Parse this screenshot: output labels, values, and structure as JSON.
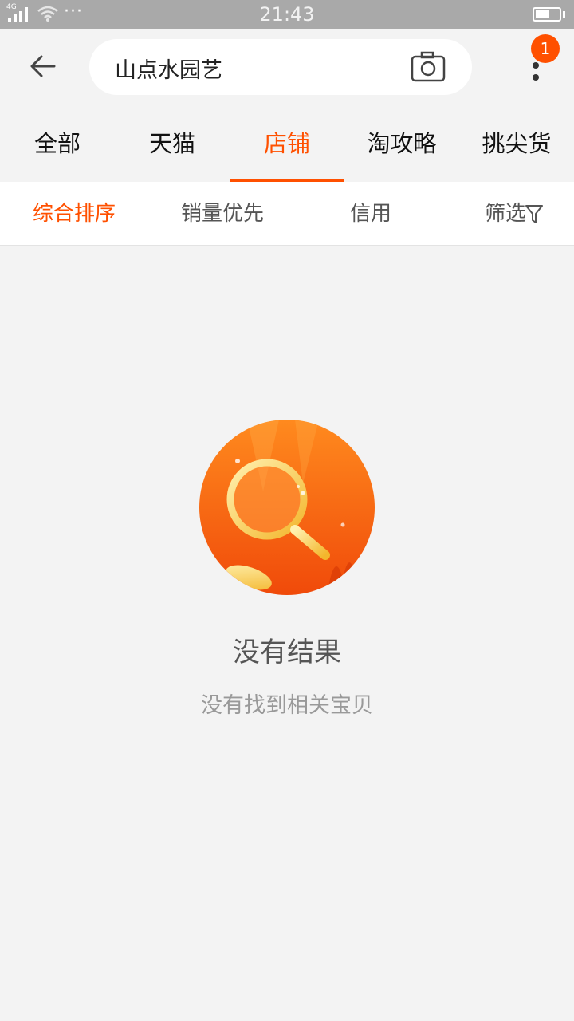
{
  "status_bar": {
    "time": "21:43",
    "network": "4G",
    "overflow": "···",
    "battery_level": 0.6
  },
  "header": {
    "search_query": "山点水园艺",
    "menu_badge": "1"
  },
  "tabs": [
    {
      "label": "全部"
    },
    {
      "label": "天猫"
    },
    {
      "label": "店铺",
      "active": true
    },
    {
      "label": "淘攻略"
    },
    {
      "label": "挑尖货"
    }
  ],
  "sort_bar": {
    "items": [
      {
        "label": "综合排序",
        "active": true
      },
      {
        "label": "销量优先"
      },
      {
        "label": "信用"
      }
    ],
    "filter_label": "筛选"
  },
  "empty_state": {
    "title": "没有结果",
    "subtitle": "没有找到相关宝贝"
  },
  "colors": {
    "accent": "#ff5000",
    "status_bar_bg": "#a9a9a9",
    "page_bg": "#f3f3f3"
  },
  "icons": [
    "back-arrow-icon",
    "camera-icon",
    "more-vertical-icon",
    "filter-icon",
    "magnifier-illustration",
    "signal-icon",
    "wifi-icon",
    "battery-icon"
  ]
}
